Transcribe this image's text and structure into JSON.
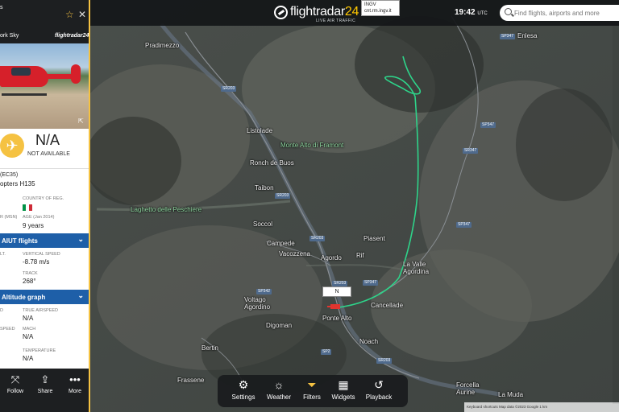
{
  "topbar": {
    "logo_main": "flightradar",
    "logo_num": "24",
    "logo_sub": "LIVE AIR TRAFFIC",
    "tooltip_line1": "INGV",
    "tooltip_line2": "cnt.rm.ingv.it",
    "time": "19:42",
    "time_zone": "UTC",
    "search_placeholder": "Find flights, airports and more"
  },
  "panel": {
    "route_text": "s",
    "airline": "ork Sky",
    "brand": "flightradar24",
    "callsign": "N/A",
    "status": "NOT AVAILABLE",
    "aircraft_code": "(EC35)",
    "aircraft_name": "opters H135",
    "country_label": "COUNTRY OF REG.",
    "msn_label": "R (MSN)",
    "age_label": "AGE (Jan 2014)",
    "age_value": "9 years",
    "flag_colors": [
      "#009246",
      "#ffffff",
      "#ce2b37"
    ],
    "section_flights": "AIUT flights",
    "alt_label": "LT.",
    "vspeed_label": "VERTICAL SPEED",
    "vspeed_value": "-8.78 m/s",
    "track_label": "TRACK",
    "track_value": "268°",
    "section_altitude": "Altitude graph",
    "d_label": "D",
    "tas_label": "TRUE AIRSPEED",
    "tas_value": "N/A",
    "speed_label": "SPEED",
    "mach_label": "MACH",
    "mach_value": "N/A",
    "temp_label": "TEMPERATURE",
    "temp_value": "N/A"
  },
  "bottom_left": {
    "follow": "Follow",
    "share": "Share",
    "more": "More"
  },
  "toolbar": {
    "settings": "Settings",
    "weather": "Weather",
    "filters": "Filters",
    "widgets": "Widgets",
    "playback": "Playback"
  },
  "map": {
    "marker_label": "N",
    "attribution": "Keyboard shortcuts   Map data ©2023 Google   1 km",
    "places": [
      "Pradimezzo",
      "Listolade",
      "Monte Alto di Framont",
      "Ronch de Buos",
      "Taibon",
      "Laghetto delle Peschiere",
      "Soccol",
      "Campede",
      "Vacozzena",
      "Agordo",
      "Piasent",
      "Rif",
      "La Valle Agordina",
      "Voltago Agordino",
      "Cancellade",
      "Digoman",
      "Ponte Alto",
      "Noach",
      "Bertin",
      "Frassene",
      "Enlesa",
      "Forcella Aurine",
      "La Muda"
    ],
    "roads": [
      "SP347",
      "SR203",
      "SP347",
      "SR347",
      "SR203",
      "SR203",
      "SP342",
      "SP347",
      "SR203",
      "SP2",
      "SP347",
      "SR203"
    ]
  },
  "colors": {
    "accent": "#f5c242",
    "section": "#1e5fa8",
    "track": "#2ed48a"
  }
}
